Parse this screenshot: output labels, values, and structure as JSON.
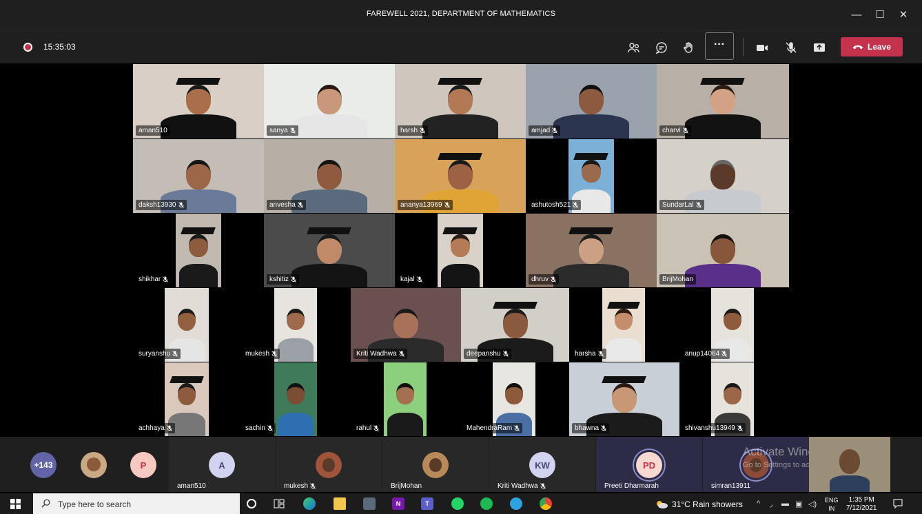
{
  "window": {
    "title": "FAREWELL 2021, DEPARTMENT OF MATHEMATICS",
    "minimize": "—",
    "maximize": "☐",
    "close": "✕"
  },
  "toolbar": {
    "timer": "15:35:03",
    "more_label": "···",
    "leave_label": "Leave",
    "leave_color": "#c4314b"
  },
  "grid_tiles": [
    {
      "name": "aman510",
      "muted": false
    },
    {
      "name": "sanya",
      "muted": true
    },
    {
      "name": "harsh",
      "muted": true
    },
    {
      "name": "amjad",
      "muted": true
    },
    {
      "name": "charvi",
      "muted": true
    },
    {
      "name": "daksh13930",
      "muted": true
    },
    {
      "name": "anvesha",
      "muted": true
    },
    {
      "name": "ananya13969",
      "muted": true
    },
    {
      "name": "ashutosh521",
      "muted": true
    },
    {
      "name": "SundarLal",
      "muted": true
    },
    {
      "name": "shikhar",
      "muted": true
    },
    {
      "name": "kshitiz",
      "muted": true
    },
    {
      "name": "kajal",
      "muted": true
    },
    {
      "name": "dhruv",
      "muted": true
    },
    {
      "name": "BrijMohan",
      "muted": false
    },
    {
      "name": "suryanshu",
      "muted": true
    },
    {
      "name": "mukesh",
      "muted": true
    },
    {
      "name": "Kriti Wadhwa",
      "muted": true
    },
    {
      "name": "deepanshu",
      "muted": true
    },
    {
      "name": "harsha",
      "muted": true
    },
    {
      "name": "anup14064",
      "muted": true
    },
    {
      "name": "achhaya",
      "muted": true
    },
    {
      "name": "sachin",
      "muted": true
    },
    {
      "name": "rahul",
      "muted": true
    },
    {
      "name": "MahendraRam",
      "muted": true
    },
    {
      "name": "bhawna",
      "muted": true
    },
    {
      "name": "shivanshu13949",
      "muted": true
    }
  ],
  "strip": {
    "overflow_count": "+143",
    "p_initial": "P",
    "items": [
      {
        "initials": "A",
        "name": "aman510"
      },
      {
        "initials": "",
        "name": "mukesh"
      },
      {
        "initials": "",
        "name": "BrijMohan"
      },
      {
        "initials": "KW",
        "name": "Kriti Wadhwa"
      },
      {
        "initials": "PD",
        "name": "Preeti Dharmarah"
      },
      {
        "initials": "",
        "name": "simran13911"
      }
    ],
    "watermark_title": "Activate Windows",
    "watermark_sub": "Go to Settings to activate Windows."
  },
  "taskbar": {
    "search_placeholder": "Type here to search",
    "weather": "31°C  Rain showers",
    "lang_top": "ENG",
    "lang_bottom": "IN",
    "time": "1:35 PM",
    "date": "7/12/2021"
  }
}
